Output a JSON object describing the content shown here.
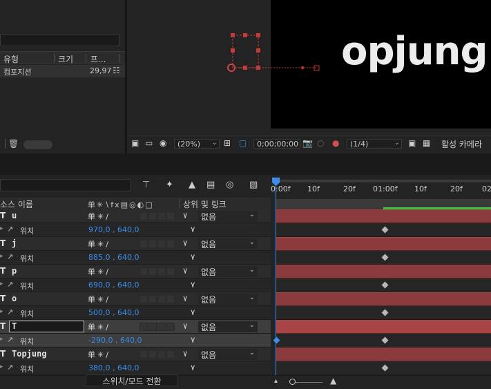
{
  "project": {
    "columns": [
      "유형",
      "크기",
      "프..."
    ],
    "row": {
      "type": "컴포지션",
      "fps": "29,97"
    }
  },
  "viewer": {
    "comp_text": "opjung",
    "zoom": "(20%)",
    "timecode": "0;00;00;00",
    "resolution": "(1/4)",
    "camera": "활성 카메라"
  },
  "timeline": {
    "columns": {
      "source_name": "소스 이름",
      "parent": "상위 및 링크"
    },
    "ruler": [
      "0:00f",
      "10f",
      "20f",
      "01:00f",
      "10f",
      "20f",
      "02"
    ],
    "layers": [
      {
        "type": "T",
        "name": "u",
        "parent": "없음",
        "prop": "위치",
        "value": "970,0 , 640,0",
        "edit": false
      },
      {
        "type": "T",
        "name": "j",
        "parent": "없음",
        "prop": "위치",
        "value": "885,0 , 640,0",
        "edit": false
      },
      {
        "type": "T",
        "name": "p",
        "parent": "없음",
        "prop": "위치",
        "value": "690,0 , 640,0",
        "edit": false
      },
      {
        "type": "T",
        "name": "o",
        "parent": "없음",
        "prop": "위치",
        "value": "500,0 , 640,0",
        "edit": false
      },
      {
        "type": "T",
        "name": "T",
        "parent": "없음",
        "prop": "위치",
        "value": "-290,0 , 640,0",
        "edit": true
      },
      {
        "type": "T",
        "name": "Topjung",
        "parent": "없음",
        "prop": "위치",
        "value": "380,0 , 640,0",
        "edit": false
      }
    ],
    "footer_button": "스위치/모드 전환"
  },
  "colors": {
    "accent_blue": "#3d8ee8",
    "layer_bar": "#8b3b3b",
    "work_green": "#3ec13e"
  }
}
